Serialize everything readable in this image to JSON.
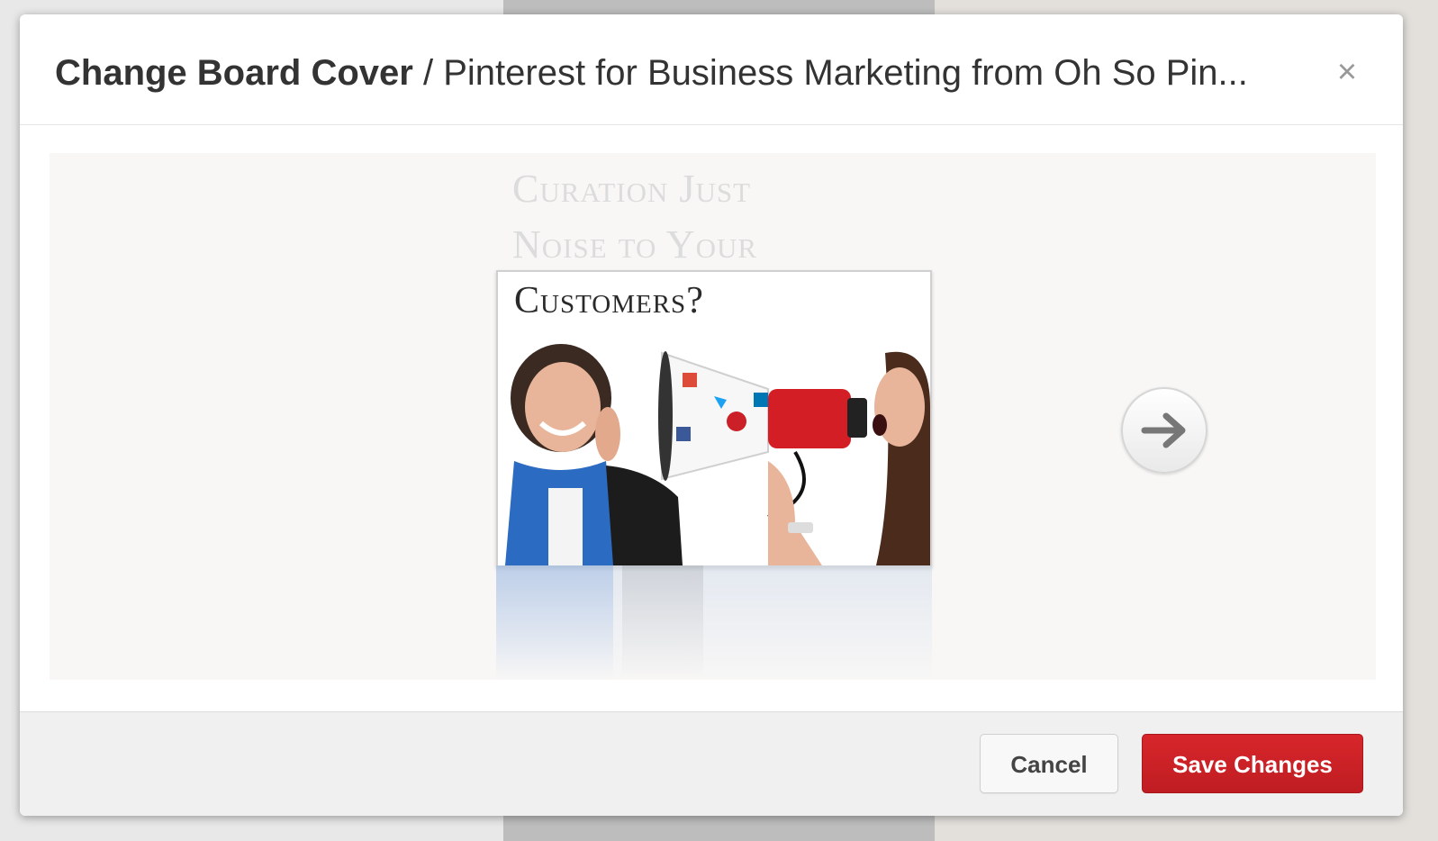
{
  "modal": {
    "title_strong": "Change Board Cover",
    "title_separator": " / ",
    "title_board": "Pinterest for Business Marketing from Oh So Pin...",
    "close_icon": "close-icon"
  },
  "cover": {
    "ghost_line1": "Curation Just",
    "ghost_line2": "Noise to Your",
    "title": "Customers?",
    "next_icon": "arrow-right-icon"
  },
  "footer": {
    "cancel_label": "Cancel",
    "save_label": "Save Changes"
  },
  "colors": {
    "save_button": "#cc2127",
    "text": "#333333"
  }
}
